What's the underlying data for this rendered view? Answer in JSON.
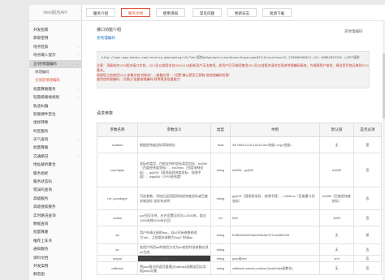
{
  "sidebar": {
    "title": "Web服务API",
    "items": [
      {
        "label": "开发指南",
        "type": "top"
      },
      {
        "label": "获取密钥",
        "type": "top"
      },
      {
        "label": "地点检索",
        "type": "top",
        "chev": "›"
      },
      {
        "label": "地点输入提示",
        "type": "top",
        "chev": "›"
      },
      {
        "label": "正/逆地理编码",
        "type": "active",
        "chev": "⌄"
      },
      {
        "label": "地理编码",
        "type": "sub"
      },
      {
        "label": "全球逆地理编码",
        "type": "sub current"
      },
      {
        "label": "批量算路服务",
        "type": "top",
        "chev": "›"
      },
      {
        "label": "轻量级路线规划",
        "type": "top",
        "chev": "›"
      },
      {
        "label": "轨迹纠偏",
        "type": "top"
      },
      {
        "label": "智能硬件定位",
        "type": "top"
      },
      {
        "label": "坐标转换",
        "type": "top"
      },
      {
        "label": "时区服务",
        "type": "top"
      },
      {
        "label": "天气查询",
        "type": "top",
        "chev": "›"
      },
      {
        "label": "批量算路",
        "type": "top"
      },
      {
        "label": "交通路况",
        "type": "top",
        "chev": "›"
      },
      {
        "label": "地址解析聚合",
        "type": "top"
      },
      {
        "label": "服务指标",
        "type": "top"
      },
      {
        "label": "服务状态码",
        "type": "top"
      },
      {
        "label": "错误码查询",
        "type": "top"
      },
      {
        "label": "高级服务",
        "type": "top"
      },
      {
        "label": "高级搜索服务",
        "type": "top"
      },
      {
        "label": "实时路况查询",
        "type": "top"
      },
      {
        "label": "数据查询",
        "type": "top"
      },
      {
        "label": "批量算路",
        "type": "top"
      },
      {
        "label": "推荐上车点",
        "type": "top"
      },
      {
        "label": "通知服务",
        "type": "top"
      },
      {
        "label": "资料文档",
        "type": "top"
      },
      {
        "label": "开发案例",
        "type": "top"
      },
      {
        "label": "静态图",
        "type": "top"
      },
      {
        "label": "资料文档",
        "type": "top"
      }
    ]
  },
  "tabs": [
    {
      "label": "服务介绍",
      "active": false
    },
    {
      "label": "服务文档",
      "active": true
    },
    {
      "label": "使用须知",
      "active": false
    },
    {
      "label": "常见问题",
      "active": false
    },
    {
      "label": "更新日志",
      "active": false
    },
    {
      "label": "资源下载",
      "active": false
    }
  ],
  "main": {
    "section1": "接口功能介绍",
    "sub1": "逆地理编码",
    "right_link": "逆地理编码",
    "code_line1": "http://api.map.baidu.com/reverse_geocoding/v3/?ak=您的ak&output=json&coordtype=wgs84ll&location=31.225696563611,121.49884033194  //GET请求",
    "notice_line1": "注意：顶级域名V3.0版本接口文档，V2.0及以前版本自2019.6.18起新用户无法使用。老用户仍可继续使用V2.0及以前版本请求实现逆地理编码服务，为保障用户体验，建议您尽快迁移到V3.0版本。",
    "notice_line2": "如果您之前使用V2.0 参看文档“控制台”→“查看应用”→“设置”确认是否已获取“逆地理编码权限”",
    "notice_line3": "使用逆地理编码，可通过“批量地理编码”获得更多批量能力",
    "section2": "请求参数"
  },
  "table": {
    "headers": [
      "参数名称",
      "参数含义",
      "类型",
      "举例",
      "默认值",
      "是否必须"
    ],
    "rows": [
      [
        "location",
        "根据经纬度坐标获取地址",
        "float",
        "38.76623,116.43213 lat<纬度>,lng<经度>",
        "无",
        "是"
      ],
      [
        "coordtype",
        "坐标的类型，目前支持的坐标类型包括：bd09ll（百度经纬度坐标）、bd09mc（百度米制坐标）、gcj02ll（国测局经纬度坐标，仅限中国）、wgs84ll（GPS经纬度）",
        "string",
        "bd09ll、gcj02ll",
        "bd09ll",
        "否"
      ],
      [
        "ret_coordtype",
        "可选参数，添加后返回国测局经纬度坐标或百度米制坐标 坐标系说明",
        "string",
        "gcj02ll（国测局坐标，仅限中国）、bd09mc（百度墨卡托坐标）",
        "bd09ll（百度经纬度坐标）",
        "否"
      ],
      [
        "radius",
        "poi召回半径，允许设置区间为0-1000米，超过1000米按1000米召回",
        "int",
        "500",
        "1000",
        "否"
      ],
      [
        "ak",
        "用户申请注册的key，自v2开始参数修改为“ak”，之前版本参数为“key” 申请ak",
        "string",
        "E4805d16520de693a3fe707cdc962045",
        "无",
        "是"
      ],
      [
        "sn",
        "若用户所用ak的校验方式为sn校验时该参数必须 sn生成",
        "string",
        "",
        "无",
        "否"
      ],
      [
        "output",
        "输出格式为json或者xml",
        "string",
        "json或xml",
        "xml",
        "否"
      ],
      [
        "callback",
        "将json格式的返回值通过callback函数返回以实现jsonp功能",
        "string",
        "callback=showLocation(JavaScript函数名)",
        "无",
        "否"
      ]
    ]
  }
}
